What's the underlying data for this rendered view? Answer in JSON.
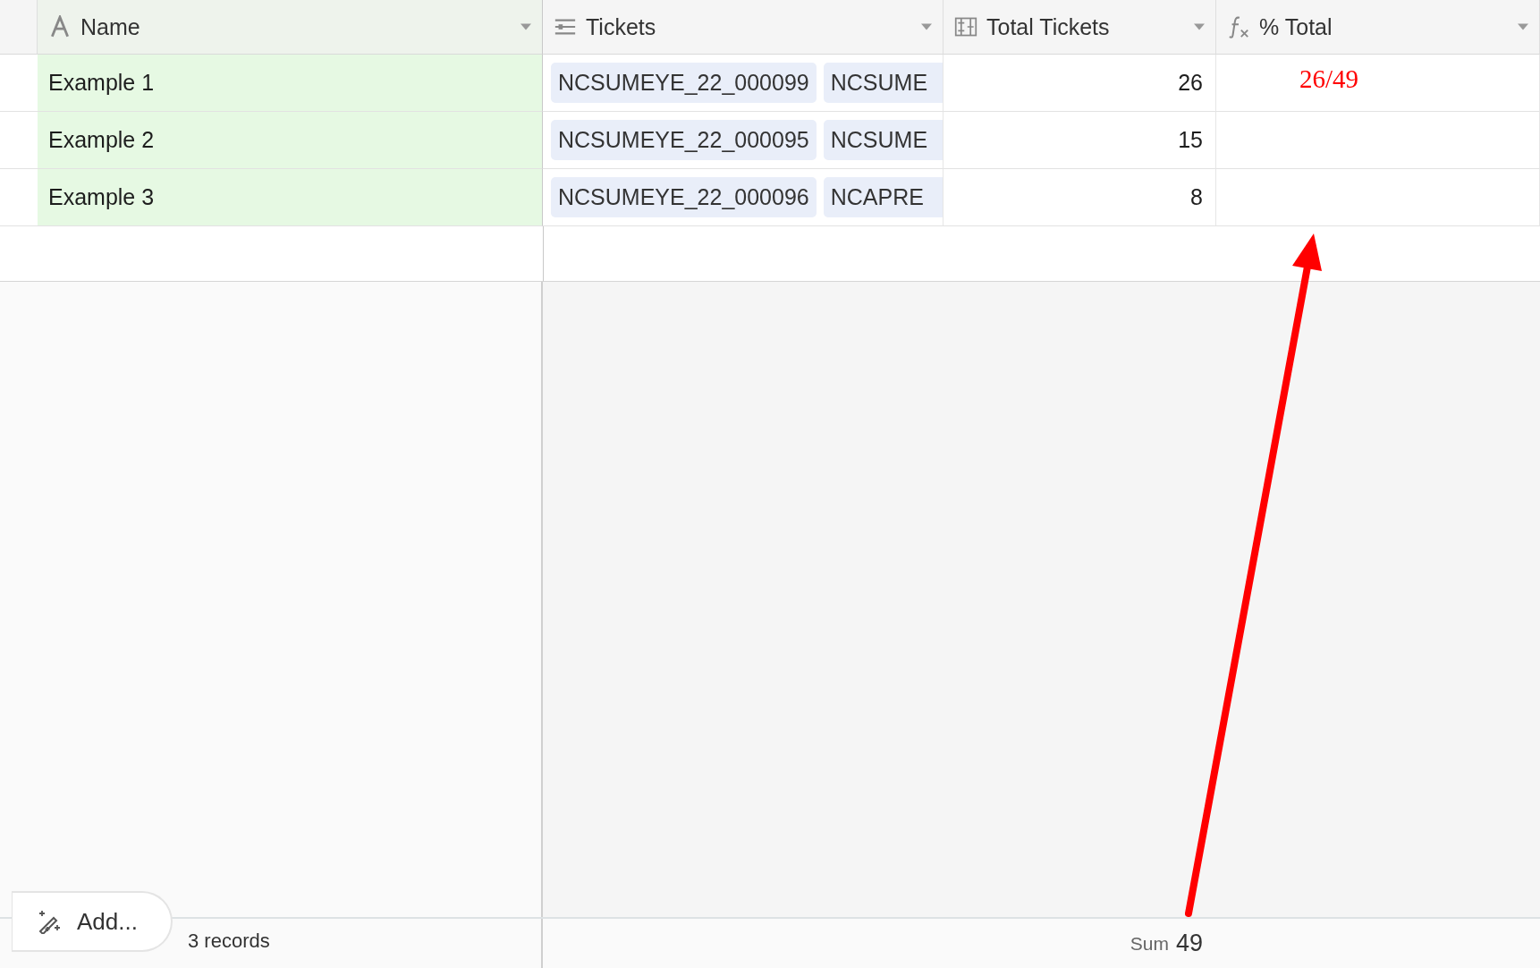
{
  "columns": [
    {
      "name": "Name",
      "kind": "text"
    },
    {
      "name": "Tickets",
      "kind": "link"
    },
    {
      "name": "Total Tickets",
      "kind": "count"
    },
    {
      "name": "% Total",
      "kind": "formula"
    }
  ],
  "rows": [
    {
      "name": "Example 1",
      "tickets": [
        "NCSUMEYE_22_000099",
        "NCSUME"
      ],
      "total": "26"
    },
    {
      "name": "Example 2",
      "tickets": [
        "NCSUMEYE_22_000095",
        "NCSUME"
      ],
      "total": "15"
    },
    {
      "name": "Example 3",
      "tickets": [
        "NCSUMEYE_22_000096",
        "NCAPRE"
      ],
      "total": "8"
    }
  ],
  "footer": {
    "add_button": "Add...",
    "record_count": "3 records",
    "summary_label": "Sum",
    "summary_value": "49"
  },
  "annotation": {
    "text": "26/49"
  }
}
